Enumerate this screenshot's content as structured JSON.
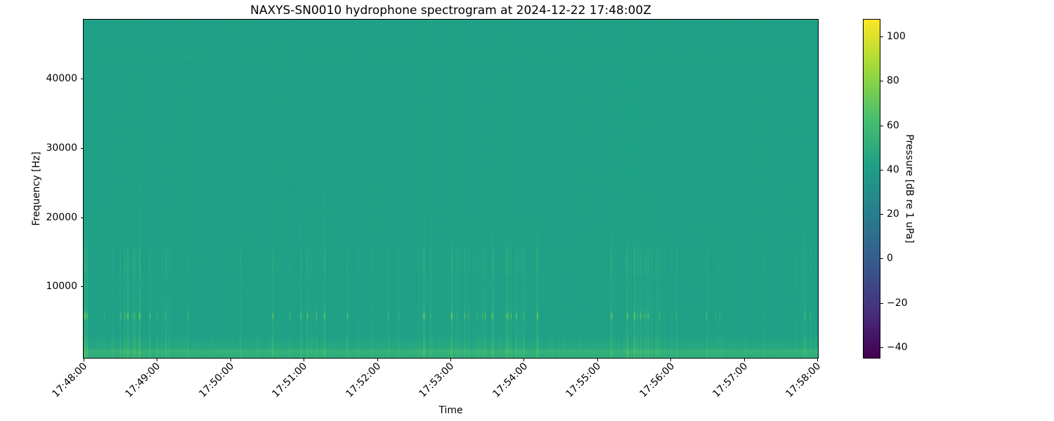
{
  "style": {
    "background": "#ffffff",
    "text_color": "#000000",
    "spine_color": "#000000"
  },
  "chart_data": {
    "type": "heatmap",
    "subtype": "spectrogram",
    "title": "NAXYS-SN0010 hydrophone spectrogram at 2024-12-22 17:48:00Z",
    "xlabel": "Time",
    "ylabel": "Frequency [Hz]",
    "x_range": [
      "17:48:00",
      "17:58:00"
    ],
    "x_tick_labels": [
      "17:48:00",
      "17:49:00",
      "17:50:00",
      "17:51:00",
      "17:52:00",
      "17:53:00",
      "17:54:00",
      "17:55:00",
      "17:56:00",
      "17:57:00",
      "17:58:00"
    ],
    "y_range_hz": [
      0,
      48500
    ],
    "y_ticks_hz": [
      10000,
      20000,
      30000,
      40000
    ],
    "y_tick_labels": [
      "40000",
      "30000",
      "20000",
      "10000"
    ],
    "grid": false,
    "legend": "none",
    "colorbar": {
      "label": "Pressure [dB re 1 uPa]",
      "ticks": [
        "100",
        "80",
        "60",
        "40",
        "20",
        "0",
        "−20",
        "−40"
      ],
      "vmin": -44.7,
      "vmax": 107.6,
      "colormap": "viridis",
      "stops": [
        "#440154",
        "#46327e",
        "#365c8d",
        "#277f8e",
        "#1fa187",
        "#4ac16d",
        "#a0da39",
        "#fde725"
      ]
    },
    "features": [
      {
        "kind": "background",
        "level_db": 42,
        "description": "uniform teal mid-level background across all frequencies and times"
      },
      {
        "kind": "band",
        "f_low_hz": 0,
        "f_high_hz": 3200,
        "level_db": 51,
        "description": "continuous brighter low-frequency noise band along the bottom"
      },
      {
        "kind": "line",
        "f_hz": 900,
        "level_db": 56,
        "description": "brightest narrow line near 0.9 kHz inside the bottom band"
      },
      {
        "kind": "clicks",
        "f_low_hz": 5200,
        "f_high_hz": 6900,
        "peak_db": 77,
        "description": "intermittent bright impulsive clicks centred near 6 kHz throughout the ten-minute record"
      },
      {
        "kind": "band",
        "f_low_hz": 11800,
        "f_high_hz": 15600,
        "level_db": 54,
        "description": "dense vertical transient striping strongest between about 12 and 15.5 kHz"
      },
      {
        "kind": "transients",
        "f_low_hz": 0,
        "f_high_hz": 22000,
        "description": "many thin broadband vertical streaks (impulses) in irregular clusters, fading above ~22 kHz"
      },
      {
        "kind": "line",
        "f_hz": 43300,
        "level_db": 44,
        "description": "very faint dashed horizontal tone near 43.3 kHz"
      }
    ],
    "spectrogram": {
      "render": {
        "seed": 20241222,
        "background_db": 42.3,
        "column_noise_db": 0.7,
        "pixel_noise_db": 0.35,
        "low_band": {
          "f_max": 3200,
          "boost_db": 9,
          "exponent": 1.1
        },
        "low_line": {
          "f_min": 600,
          "f_max": 1150,
          "boost_db": 4.5
        },
        "faint_line": {
          "f_center": 43300,
          "half_width": 260,
          "boost_db": 1.6
        },
        "click_band": {
          "f_center": 6000,
          "sigma_hz": 520,
          "per_strength": 3.4,
          "min_strength": 4
        },
        "mid_band": {
          "f_min": 11800,
          "f_max": 15600,
          "per_strength": 0.55
        },
        "lowfreq_profile": {
          "f_cut": 22000,
          "per_strength": 0.9
        },
        "broadband": {
          "scale_hz": 28000,
          "per_strength": 0.3
        },
        "low_band_event": 0.4,
        "event_base_p": 0.18,
        "event_mod1_amp": 0.07,
        "event_mod1_period": 40,
        "event_mod2_amp": 0.05,
        "event_mod2_period": 11,
        "event_min_strength": 1.5,
        "event_max_extra": 9,
        "event_power": 3,
        "event_double_p": 0.38,
        "event_carry": 0.6
      }
    }
  }
}
